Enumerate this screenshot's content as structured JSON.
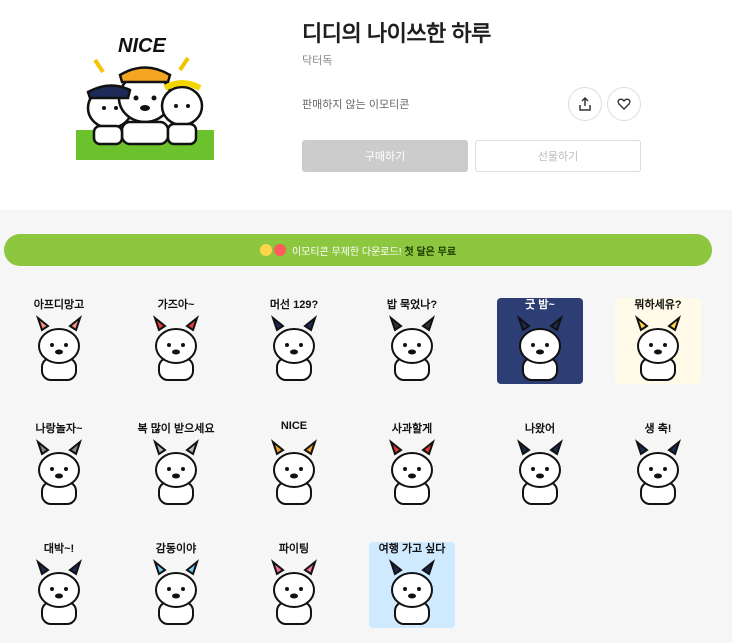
{
  "product": {
    "title": "디디의 나이쓰한 하루",
    "author": "닥터독",
    "status": "판매하지 않는 이모티콘",
    "buy_label": "구매하기",
    "gift_label": "선물하기",
    "hero_text": "NICE"
  },
  "icons": {
    "share": "share-icon",
    "like": "heart-icon"
  },
  "banner": {
    "text": "이모티콘 무제한 다운로드!",
    "highlight": "첫 달은 무료"
  },
  "stickers": [
    {
      "label": "아프디망고"
    },
    {
      "label": "가즈아~"
    },
    {
      "label": "머선 129?"
    },
    {
      "label": "밥 묵었나?"
    },
    {
      "label": "굿 밤~"
    },
    {
      "label": "뭐하세유?"
    },
    {
      "label": "나랑놀자~"
    },
    {
      "label": "복 많이 받으세요"
    },
    {
      "label": "NICE"
    },
    {
      "label": "사과할게"
    },
    {
      "label": "나왔어"
    },
    {
      "label": "생   축!"
    },
    {
      "label": "대박~!"
    },
    {
      "label": "감동이야"
    },
    {
      "label": "파이팅"
    },
    {
      "label": "여행 가고 싶다"
    }
  ],
  "colors": {
    "banner": "#8dc63f",
    "buy_disabled": "#cccccc",
    "background_alt": "#f6f6f6"
  }
}
